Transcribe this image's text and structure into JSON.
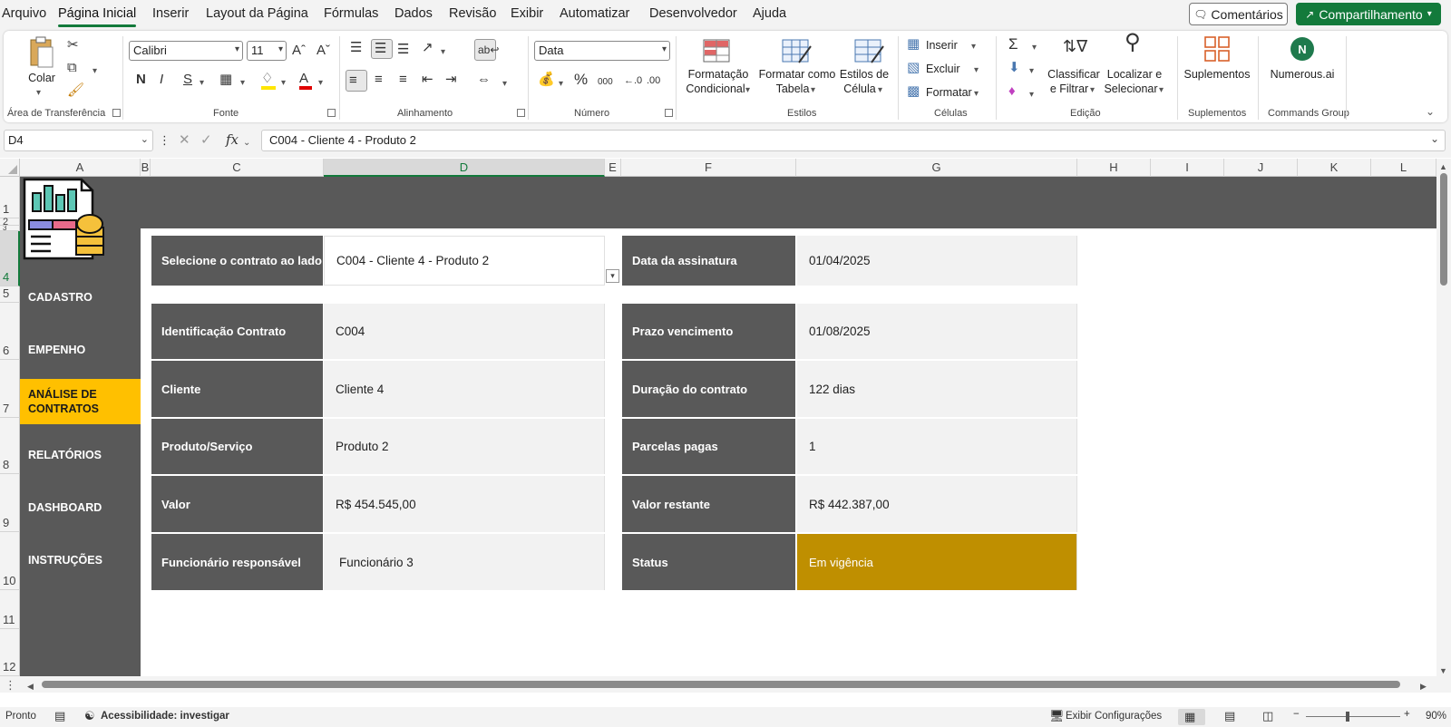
{
  "menu": {
    "tabs": [
      {
        "label": "Arquivo"
      },
      {
        "label": "Página Inicial"
      },
      {
        "label": "Inserir"
      },
      {
        "label": "Layout da Página"
      },
      {
        "label": "Fórmulas"
      },
      {
        "label": "Dados"
      },
      {
        "label": "Revisão"
      },
      {
        "label": "Exibir"
      },
      {
        "label": "Automatizar"
      },
      {
        "label": "Desenvolvedor"
      },
      {
        "label": "Ajuda"
      }
    ],
    "active_tab": "Página Inicial",
    "comments_label": "Comentários",
    "share_label": "Compartilhamento",
    "accent": "#137a3b"
  },
  "ribbon": {
    "clipboard": {
      "paste_label": "Colar",
      "group_label": "Área de Transferência"
    },
    "font": {
      "family": "Calibri",
      "size": "11",
      "group_label": "Fonte",
      "bold_glyph": "N",
      "italic_glyph": "I",
      "strike_glyph": "S"
    },
    "alignment": {
      "group_label": "Alinhamento"
    },
    "number": {
      "format": "Data",
      "group_label": "Número",
      "thousands_glyph": "000"
    },
    "styles": {
      "conditional_line1": "Formatação",
      "conditional_line2": "Condicional",
      "table_line1": "Formatar como",
      "table_line2": "Tabela",
      "cell_line1": "Estilos de",
      "cell_line2": "Célula",
      "group_label": "Estilos"
    },
    "cells": {
      "insert": "Inserir",
      "delete": "Excluir",
      "format": "Formatar",
      "group_label": "Células"
    },
    "editing": {
      "sort_line1": "Classificar",
      "sort_line2": "e Filtrar",
      "find_line1": "Localizar e",
      "find_line2": "Selecionar",
      "group_label": "Edição"
    },
    "addins": {
      "label": "Suplementos",
      "group_label": "Suplementos"
    },
    "commands": {
      "label": "Numerous.ai",
      "group_label": "Commands Group"
    }
  },
  "formula_bar": {
    "name_box": "D4",
    "formula": "C004 - Cliente 4 - Produto 2"
  },
  "columns": [
    "A",
    "B",
    "C",
    "D",
    "E",
    "F",
    "G",
    "H",
    "I",
    "J",
    "K",
    "L"
  ],
  "rows": [
    "1",
    "2",
    "3",
    "4",
    "5",
    "6",
    "7",
    "8",
    "9",
    "10",
    "11",
    "12"
  ],
  "sidebar": {
    "items": [
      {
        "label": "CADASTRO"
      },
      {
        "label": "EMPENHO"
      },
      {
        "label": "ANÁLISE DE CONTRATOS"
      },
      {
        "label": "RELATÓRIOS"
      },
      {
        "label": "DASHBOARD"
      },
      {
        "label": "INSTRUÇÕES"
      }
    ],
    "active": "ANÁLISE DE CONTRATOS",
    "active_color": "#ffc000"
  },
  "form": {
    "select_label": "Selecione o contrato ao lado",
    "select_value": "C004 - Cliente 4 - Produto 2",
    "left": [
      {
        "label": "Identificação Contrato",
        "value": "C004"
      },
      {
        "label": "Cliente",
        "value": "Cliente 4"
      },
      {
        "label": "Produto/Serviço",
        "value": "Produto 2"
      },
      {
        "label": "Valor",
        "value": "R$ 454.545,00"
      },
      {
        "label": "Funcionário responsável",
        "value": "Funcionário 3"
      }
    ],
    "signature_label": "Data da assinatura",
    "signature_value": "01/04/2025",
    "right": [
      {
        "label": "Prazo vencimento",
        "value": "01/08/2025"
      },
      {
        "label": "Duração do contrato",
        "value": "122 dias"
      },
      {
        "label": "Parcelas pagas",
        "value": "1"
      },
      {
        "label": "Valor restante",
        "value": "R$ 442.387,00"
      },
      {
        "label": "Status",
        "value": "Em vigência"
      }
    ],
    "status_color": "#bf8f00",
    "header_color": "#595959"
  },
  "status_bar": {
    "ready": "Pronto",
    "accessibility": "Acessibilidade: investigar",
    "display_settings": "Exibir Configurações",
    "zoom": "90%"
  }
}
